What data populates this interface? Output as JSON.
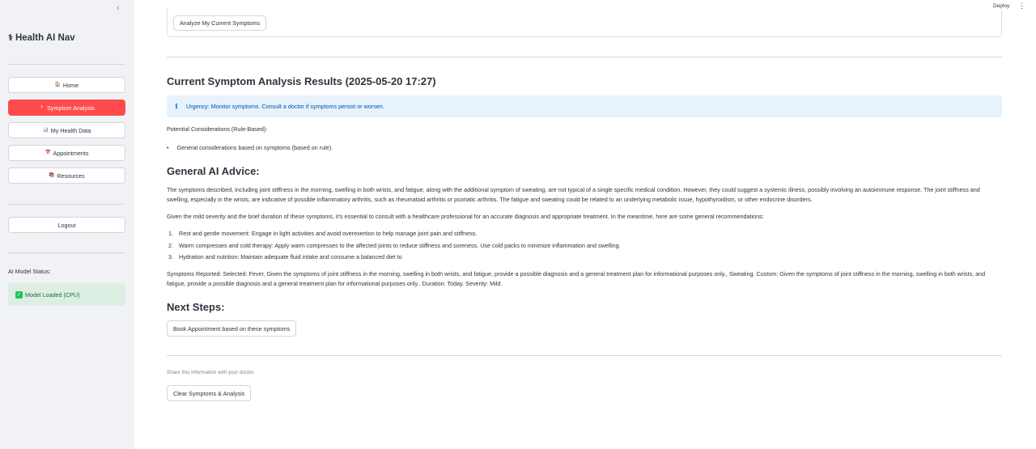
{
  "sidebar": {
    "collapse_glyph": "‹",
    "brand": {
      "icon": "staff-of-aesculapius-icon",
      "glyph": "⚕",
      "title": "Health AI Nav"
    },
    "nav": [
      {
        "label": "Home",
        "icon": "house-icon",
        "glyph": "🏠",
        "active": false
      },
      {
        "label": "Symptom Analysis",
        "icon": "stethoscope-icon",
        "glyph": "⚕",
        "active": true
      },
      {
        "label": "My Health Data",
        "icon": "bar-chart-icon",
        "glyph": "📊",
        "active": false
      },
      {
        "label": "Appointments",
        "icon": "calendar-icon",
        "glyph": "📅",
        "active": false
      },
      {
        "label": "Resources",
        "icon": "books-icon",
        "glyph": "📚",
        "active": false
      }
    ],
    "logout_label": "Logout",
    "status_label": "AI Model Status:",
    "status": {
      "icon": "check-icon",
      "glyph": "✓",
      "text": "Model Loaded (CPU)"
    }
  },
  "topbar": {
    "deploy_label": "Deploy",
    "menu_glyph": "⋮"
  },
  "main": {
    "analyze_button": "Analyze My Current Symptoms",
    "results_title": "Current Symptom Analysis Results (2025-05-20 17:27)",
    "urgency": {
      "icon": "info-icon",
      "glyph": "ℹ",
      "text": "Urgency: Monitor symptoms. Consult a doctor if symptoms persist or worsen."
    },
    "considerations_label": "Potential Considerations (Rule-Based):",
    "considerations": [
      "General considerations based on symptoms (based on rule)."
    ],
    "ai_advice_title": "General AI Advice:",
    "advice_para1": "The symptoms described, including joint stiffness in the morning, swelling in both wrists, and fatigue, along with the additional symptom of sweating, are not typical of a single specific medical condition. However, they could suggest a systemic illness, possibly involving an autoimmune response. The joint stiffness and swelling, especially in the wrists, are indicative of possible inflammatory arthritis, such as rheumatoid arthritis or psoriatic arthritis. The fatigue and sweating could be related to an underlying metabolic issue, hypothyroidism, or other endocrine disorders.",
    "advice_para2": "Given the mild severity and the brief duration of these symptoms, it's essential to consult with a healthcare professional for an accurate diagnosis and appropriate treatment. In the meantime, here are some general recommendations:",
    "recommendations": [
      {
        "num": "1.",
        "text": "Rest and gentle movement: Engage in light activities and avoid overexertion to help manage joint pain and stiffness."
      },
      {
        "num": "2.",
        "text": "Warm compresses and cold therapy: Apply warm compresses to the affected joints to reduce stiffness and soreness. Use cold packs to minimize inflammation and swelling."
      },
      {
        "num": "3.",
        "text": "Hydration and nutrition: Maintain adequate fluid intake and consume a balanced diet to"
      }
    ],
    "symptoms_reported": "Symptoms Reported: Selected: Fever, Given the symptoms of joint stiffness in the morning, swelling in both wrists, and fatigue, provide a possible diagnosis and a general treatment plan for informational purposes only., Sweating. Custom: Given the symptoms of joint stiffness in the morning, swelling in both wrists, and fatigue, provide a possible diagnosis and a general treatment plan for informational purposes only.. Duration: Today. Severity: Mild.",
    "next_steps_title": "Next Steps:",
    "book_button": "Book Appointment based on these symptoms",
    "share_note": "Share this information with your doctor.",
    "clear_button": "Clear Symptoms & Analysis"
  },
  "colors": {
    "accent": "#ff4b4b",
    "sidebar_bg": "#f0f2f6",
    "info_bg": "#e8f2fc",
    "success_bg": "#dcefe2"
  }
}
